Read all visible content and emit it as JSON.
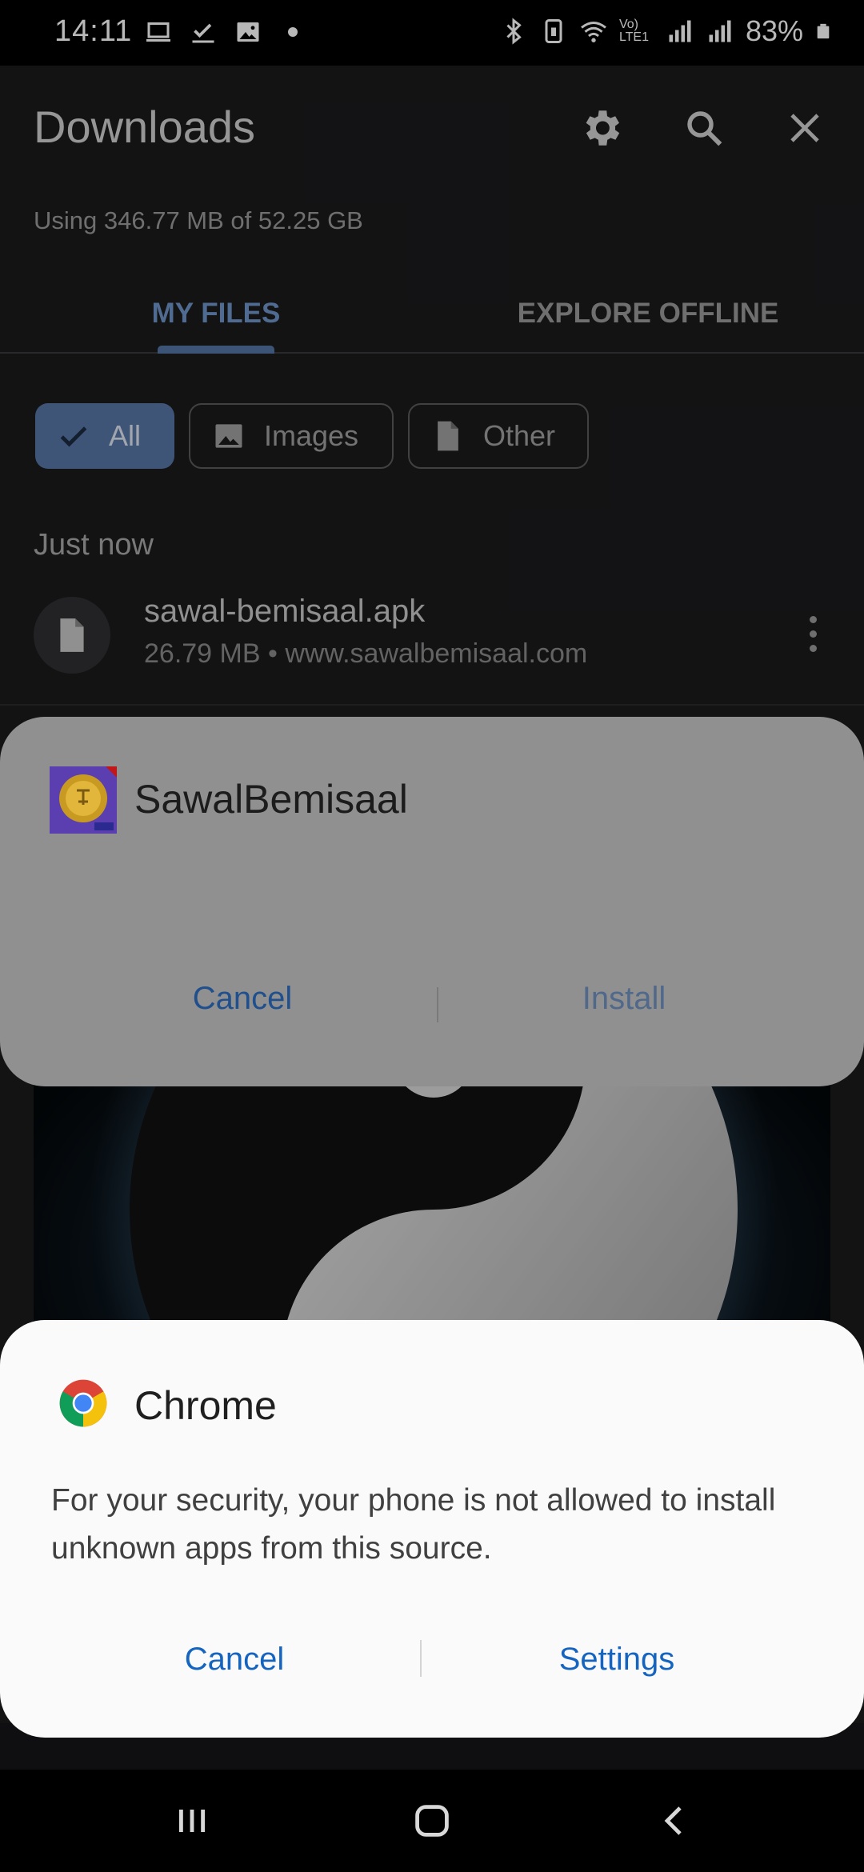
{
  "status_bar": {
    "time": "14:11",
    "battery_percent": "83%",
    "network_label": "Vo) LTE1",
    "icons": [
      "laptop-icon",
      "checkbox-icon",
      "image-icon",
      "dot-icon",
      "bluetooth-icon",
      "nfc-icon",
      "wifi-icon",
      "signal-icon",
      "signal-icon",
      "battery-icon"
    ]
  },
  "header": {
    "title": "Downloads",
    "settings_icon": "gear-icon",
    "search_icon": "search-icon",
    "close_icon": "close-icon",
    "storage_text": "Using 346.77 MB of 52.25 GB"
  },
  "tabs": [
    {
      "label": "MY FILES",
      "active": true
    },
    {
      "label": "EXPLORE OFFLINE",
      "active": false
    }
  ],
  "filters": [
    {
      "label": "All",
      "icon": "check-icon",
      "selected": true
    },
    {
      "label": "Images",
      "icon": "image-icon",
      "selected": false
    },
    {
      "label": "Other",
      "icon": "file-icon",
      "selected": false
    }
  ],
  "section": {
    "label": "Just now"
  },
  "file": {
    "name": "sawal-bemisaal.apk",
    "meta": "26.79 MB • www.sawalbemisaal.com",
    "icon": "file-icon"
  },
  "installer_dialog": {
    "app_name": "SawalBemisaal",
    "cancel_label": "Cancel",
    "install_label": "Install"
  },
  "security_dialog": {
    "app_name": "Chrome",
    "message": "For your security, your phone is not allowed to install unknown apps from this source.",
    "cancel_label": "Cancel",
    "settings_label": "Settings"
  },
  "nav_bar": {
    "recents_icon": "recents-icon",
    "home_icon": "home-icon",
    "back_icon": "back-icon"
  },
  "colors": {
    "accent": "#5877a7",
    "dialog_button": "#1565c0",
    "background": "#1b1b1d"
  }
}
